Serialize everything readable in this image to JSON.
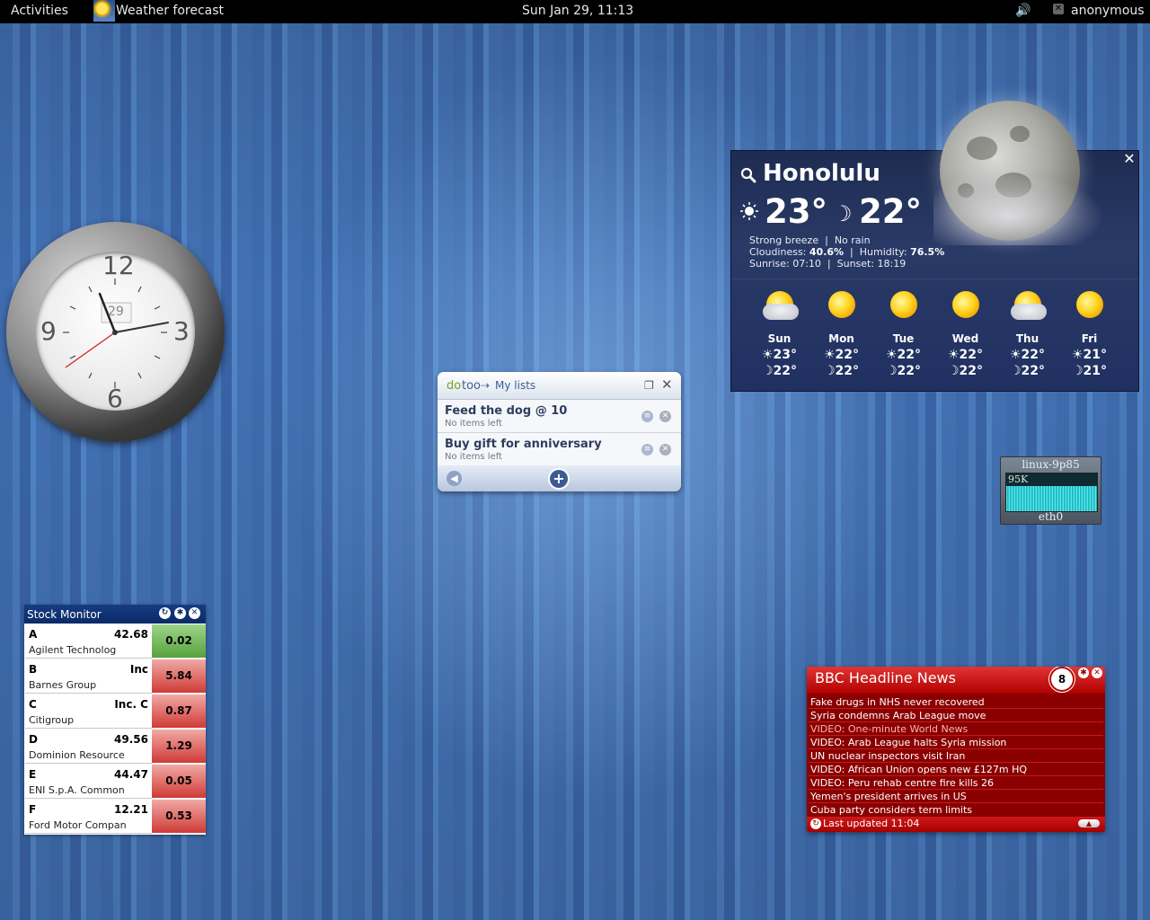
{
  "topbar": {
    "activities": "Activities",
    "app_title": "Weather forecast",
    "datetime": "Sun Jan 29, 11:13",
    "user": "anonymous",
    "icons": [
      "weather-app-icon",
      "volume-icon",
      "user-status-icon"
    ]
  },
  "clock": {
    "numerals": {
      "n12": "12",
      "n3": "3",
      "n6": "6",
      "n9": "9"
    },
    "date": "29"
  },
  "weather": {
    "city": "Honolulu",
    "current_high": "23°",
    "current_low": "22°",
    "wind": "Strong breeze",
    "rain": "No rain",
    "cloudiness_label": "Cloudiness:",
    "cloudiness": "40.6%",
    "humidity_label": "Humidity:",
    "humidity": "76.5%",
    "sunrise": "Sunrise: 07:10",
    "sunset": "Sunset: 18:19",
    "forecast": [
      {
        "day": "Sun",
        "high": "☀23°",
        "low": "☽22°",
        "icon": "partly-cloudy-icon"
      },
      {
        "day": "Mon",
        "high": "☀22°",
        "low": "☽22°",
        "icon": "sunny-icon"
      },
      {
        "day": "Tue",
        "high": "☀22°",
        "low": "☽22°",
        "icon": "sunny-icon"
      },
      {
        "day": "Wed",
        "high": "☀22°",
        "low": "☽22°",
        "icon": "sunny-icon"
      },
      {
        "day": "Thu",
        "high": "☀22°",
        "low": "☽22°",
        "icon": "partly-cloudy-icon"
      },
      {
        "day": "Fri",
        "high": "☀21°",
        "low": "☽21°",
        "icon": "sunny-icon"
      }
    ]
  },
  "dotoo": {
    "logo_do": "do",
    "logo_too": "too",
    "header": "My lists",
    "items": [
      {
        "title": "Feed the dog @ 10",
        "subtitle": "No items left"
      },
      {
        "title": "Buy gift for anniversary",
        "subtitle": "No items left"
      }
    ]
  },
  "netmon": {
    "host": "linux-9p85",
    "rate": "95K",
    "iface": "eth0"
  },
  "stock": {
    "title": "Stock Monitor",
    "rows": [
      {
        "symbol": "A",
        "price": "42.68",
        "name": "Agilent Technolog",
        "change": "0.02",
        "direction": "up"
      },
      {
        "symbol": "B",
        "price": "Inc",
        "name": "Barnes Group",
        "change": "5.84",
        "direction": "down"
      },
      {
        "symbol": "C",
        "price": "Inc. C",
        "name": "Citigroup",
        "change": "0.87",
        "direction": "down"
      },
      {
        "symbol": "D",
        "price": "49.56",
        "name": "Dominion Resource",
        "change": "1.29",
        "direction": "down"
      },
      {
        "symbol": "E",
        "price": "44.47",
        "name": "ENI S.p.A. Common",
        "change": "0.05",
        "direction": "down"
      },
      {
        "symbol": "F",
        "price": "12.21",
        "name": "Ford Motor Compan",
        "change": "0.53",
        "direction": "down"
      }
    ],
    "colors": {
      "up": "#56a23d",
      "down": "#cf3a36"
    }
  },
  "bbc": {
    "title": "BBC Headline News",
    "badge": "8",
    "headlines": [
      "Fake drugs in NHS never recovered",
      "Syria condemns Arab League move",
      "VIDEO: One-minute World News",
      "VIDEO: Arab League halts Syria mission",
      "UN nuclear inspectors visit Iran",
      "VIDEO: African Union opens new £127m HQ",
      "VIDEO: Peru rehab centre fire kills 26",
      "Yemen's president arrives in US",
      "Cuba party considers term limits"
    ],
    "updated": "Last updated 11:04"
  }
}
